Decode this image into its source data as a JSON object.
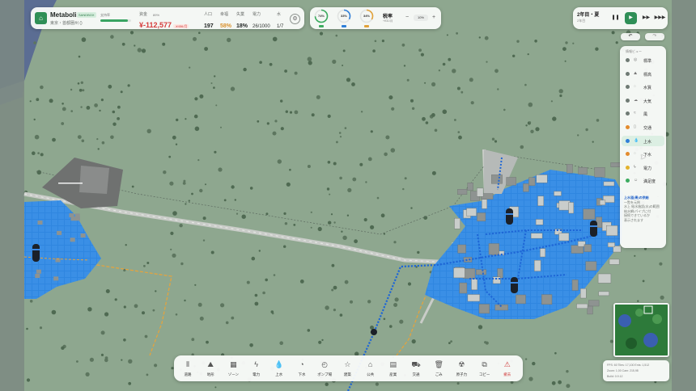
{
  "city": {
    "name": "Metabolis",
    "badge": "SANDBOX",
    "subtitle": "東京・首都圏州 ()",
    "icon": "city-icon"
  },
  "stats": {
    "approval_label": "支持率",
    "approval_value": "89%",
    "approval_fraction": 0.89,
    "money_label": "資金",
    "money_value": "¥-112,577",
    "money_delta": "-¥456/月",
    "population_label": "人口",
    "population_value": "197",
    "happiness_label": "幸福",
    "happiness_value": "58%",
    "unemployment_label": "失業",
    "unemployment_value": "18%",
    "power_label": "電力",
    "power_value": "26/1000",
    "water_label": "水",
    "water_value": "1/7"
  },
  "meters": [
    {
      "value": "74%",
      "fraction": 0.74,
      "color": "#3cab5f",
      "icon": "house-icon"
    },
    {
      "value": "33%",
      "fraction": 0.33,
      "color": "#2f7fd8",
      "icon": "factory-icon"
    },
    {
      "value": "34%",
      "fraction": 0.34,
      "color": "#e2a23a",
      "icon": "office-icon"
    }
  ],
  "tax": {
    "label": "税率",
    "sub": "+¥31/月",
    "value": "10%",
    "minus": "−",
    "plus": "+"
  },
  "time": {
    "date": "2年目・夏",
    "sub": "2年目",
    "pause": "❚❚",
    "play": "▶",
    "fast": "▶▶",
    "fastest": "▶▶▶"
  },
  "history": {
    "undo": "↶",
    "redo": "↷"
  },
  "view_menu": {
    "title": "情報ビュー",
    "items": [
      {
        "label": "標準",
        "dot": "#6f7a74",
        "glyph": "◎"
      },
      {
        "label": "標高",
        "dot": "#6f7a74",
        "glyph": "⛰"
      },
      {
        "label": "水質",
        "dot": "#6f7a74",
        "glyph": "◌"
      },
      {
        "label": "大気",
        "dot": "#6f7a74",
        "glyph": "☁"
      },
      {
        "label": "風",
        "dot": "#6f7a74",
        "glyph": "≈"
      },
      {
        "label": "交通",
        "dot": "#e38b2e",
        "glyph": "▯"
      },
      {
        "label": "上水",
        "dot": "#2f7fd8",
        "glyph": "💧"
      },
      {
        "label": "下水",
        "dot": "#e38b2e",
        "glyph": "◌"
      },
      {
        "label": "電力",
        "dot": "#e3b22e",
        "glyph": "ϟ"
      },
      {
        "label": "満足度",
        "dot": "#3cab5f",
        "glyph": "☺"
      }
    ],
    "active_index": 6,
    "description": {
      "title": "上水道(青)の供給",
      "lines": [
        "一覧を元例",
        "水上 給水施設(水)の範囲",
        "給水網/パイプに付",
        "接続できているか",
        "表示されます"
      ]
    }
  },
  "toolbar": [
    {
      "label": "道路",
      "icon": "road-icon",
      "glyph": "⫴"
    },
    {
      "label": "地形",
      "icon": "terrain-icon",
      "glyph": "⛰"
    },
    {
      "label": "ゾーン",
      "icon": "zone-icon",
      "glyph": "▦"
    },
    {
      "label": "電力",
      "icon": "power-icon",
      "glyph": "ϟ"
    },
    {
      "label": "上水",
      "icon": "water-icon",
      "glyph": "💧"
    },
    {
      "label": "下水",
      "icon": "sewage-icon",
      "glyph": "◔"
    },
    {
      "label": "ポンプ場",
      "icon": "pump-icon",
      "glyph": "◴"
    },
    {
      "label": "建築",
      "icon": "building-icon",
      "glyph": "☆"
    },
    {
      "label": "公共",
      "icon": "public-icon",
      "glyph": "⌂"
    },
    {
      "label": "産業",
      "icon": "industry-icon",
      "glyph": "▤"
    },
    {
      "label": "交通",
      "icon": "transit-icon",
      "glyph": "⛟"
    },
    {
      "label": "ごみ",
      "icon": "trash-icon",
      "glyph": "🗑"
    },
    {
      "label": "原子力",
      "icon": "nuclear-icon",
      "glyph": "☢"
    },
    {
      "label": "コピー",
      "icon": "copy-icon",
      "glyph": "⧉"
    },
    {
      "label": "撤去",
      "icon": "bulldoze-icon",
      "glyph": "⚠",
      "danger": true
    }
  ],
  "info_lines": [
    "FPS: 60   Tiles: 17,100   Ents: 1,512",
    "Zoom: 1.00   Cam: 215,98",
    "Build: 0.9.12"
  ]
}
